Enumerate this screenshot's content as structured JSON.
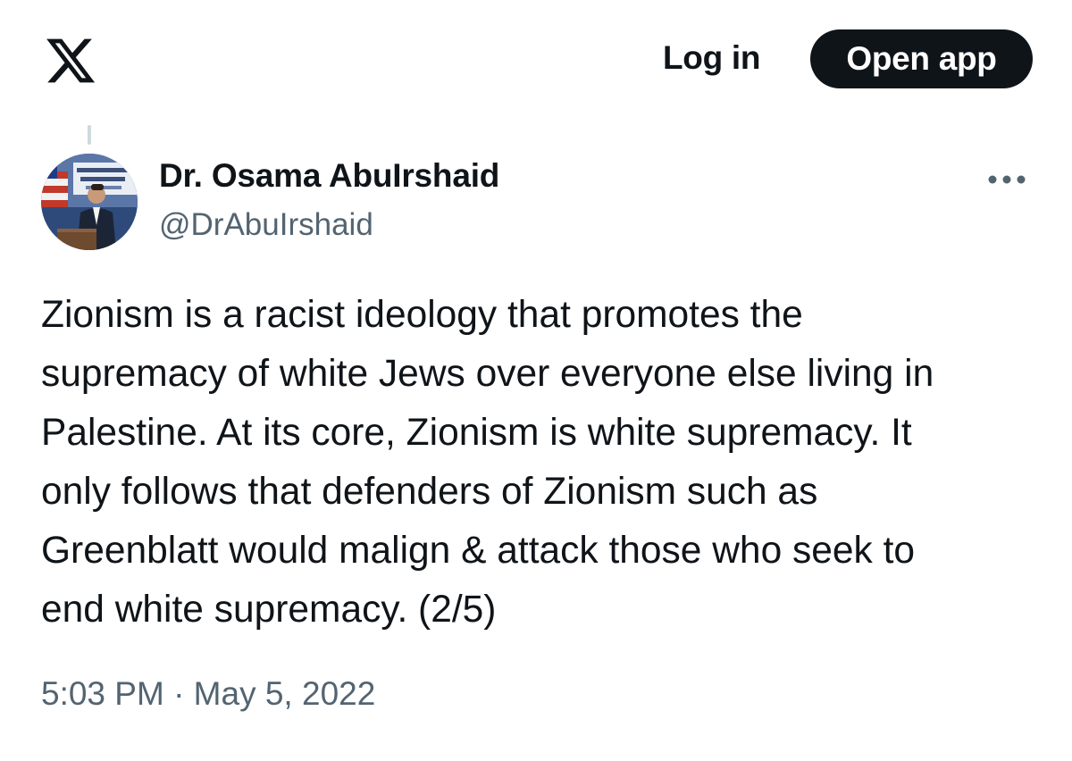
{
  "header": {
    "logo_icon": "x-logo-icon",
    "login_label": "Log in",
    "open_app_label": "Open app"
  },
  "tweet": {
    "author": {
      "display_name": "Dr. Osama AbuIrshaid",
      "handle": "@DrAbuIrshaid",
      "avatar_icon": "avatar-photo"
    },
    "more_icon": "more-horizontal-icon",
    "text": "Zionism is a racist ideology that promotes the\nsupremacy of white Jews over everyone else living in\nPalestine. At its core, Zionism is white supremacy. It\nonly follows that defenders of Zionism such as\nGreenblatt would malign & attack those who seek to\nend white supremacy. (2/5)",
    "timestamp": "5:03 PM · May 5, 2022"
  },
  "colors": {
    "primary_text": "#0f1419",
    "secondary_text": "#536471",
    "button_bg": "#0f1419",
    "button_text": "#ffffff",
    "thread_line": "#cfd9de"
  }
}
